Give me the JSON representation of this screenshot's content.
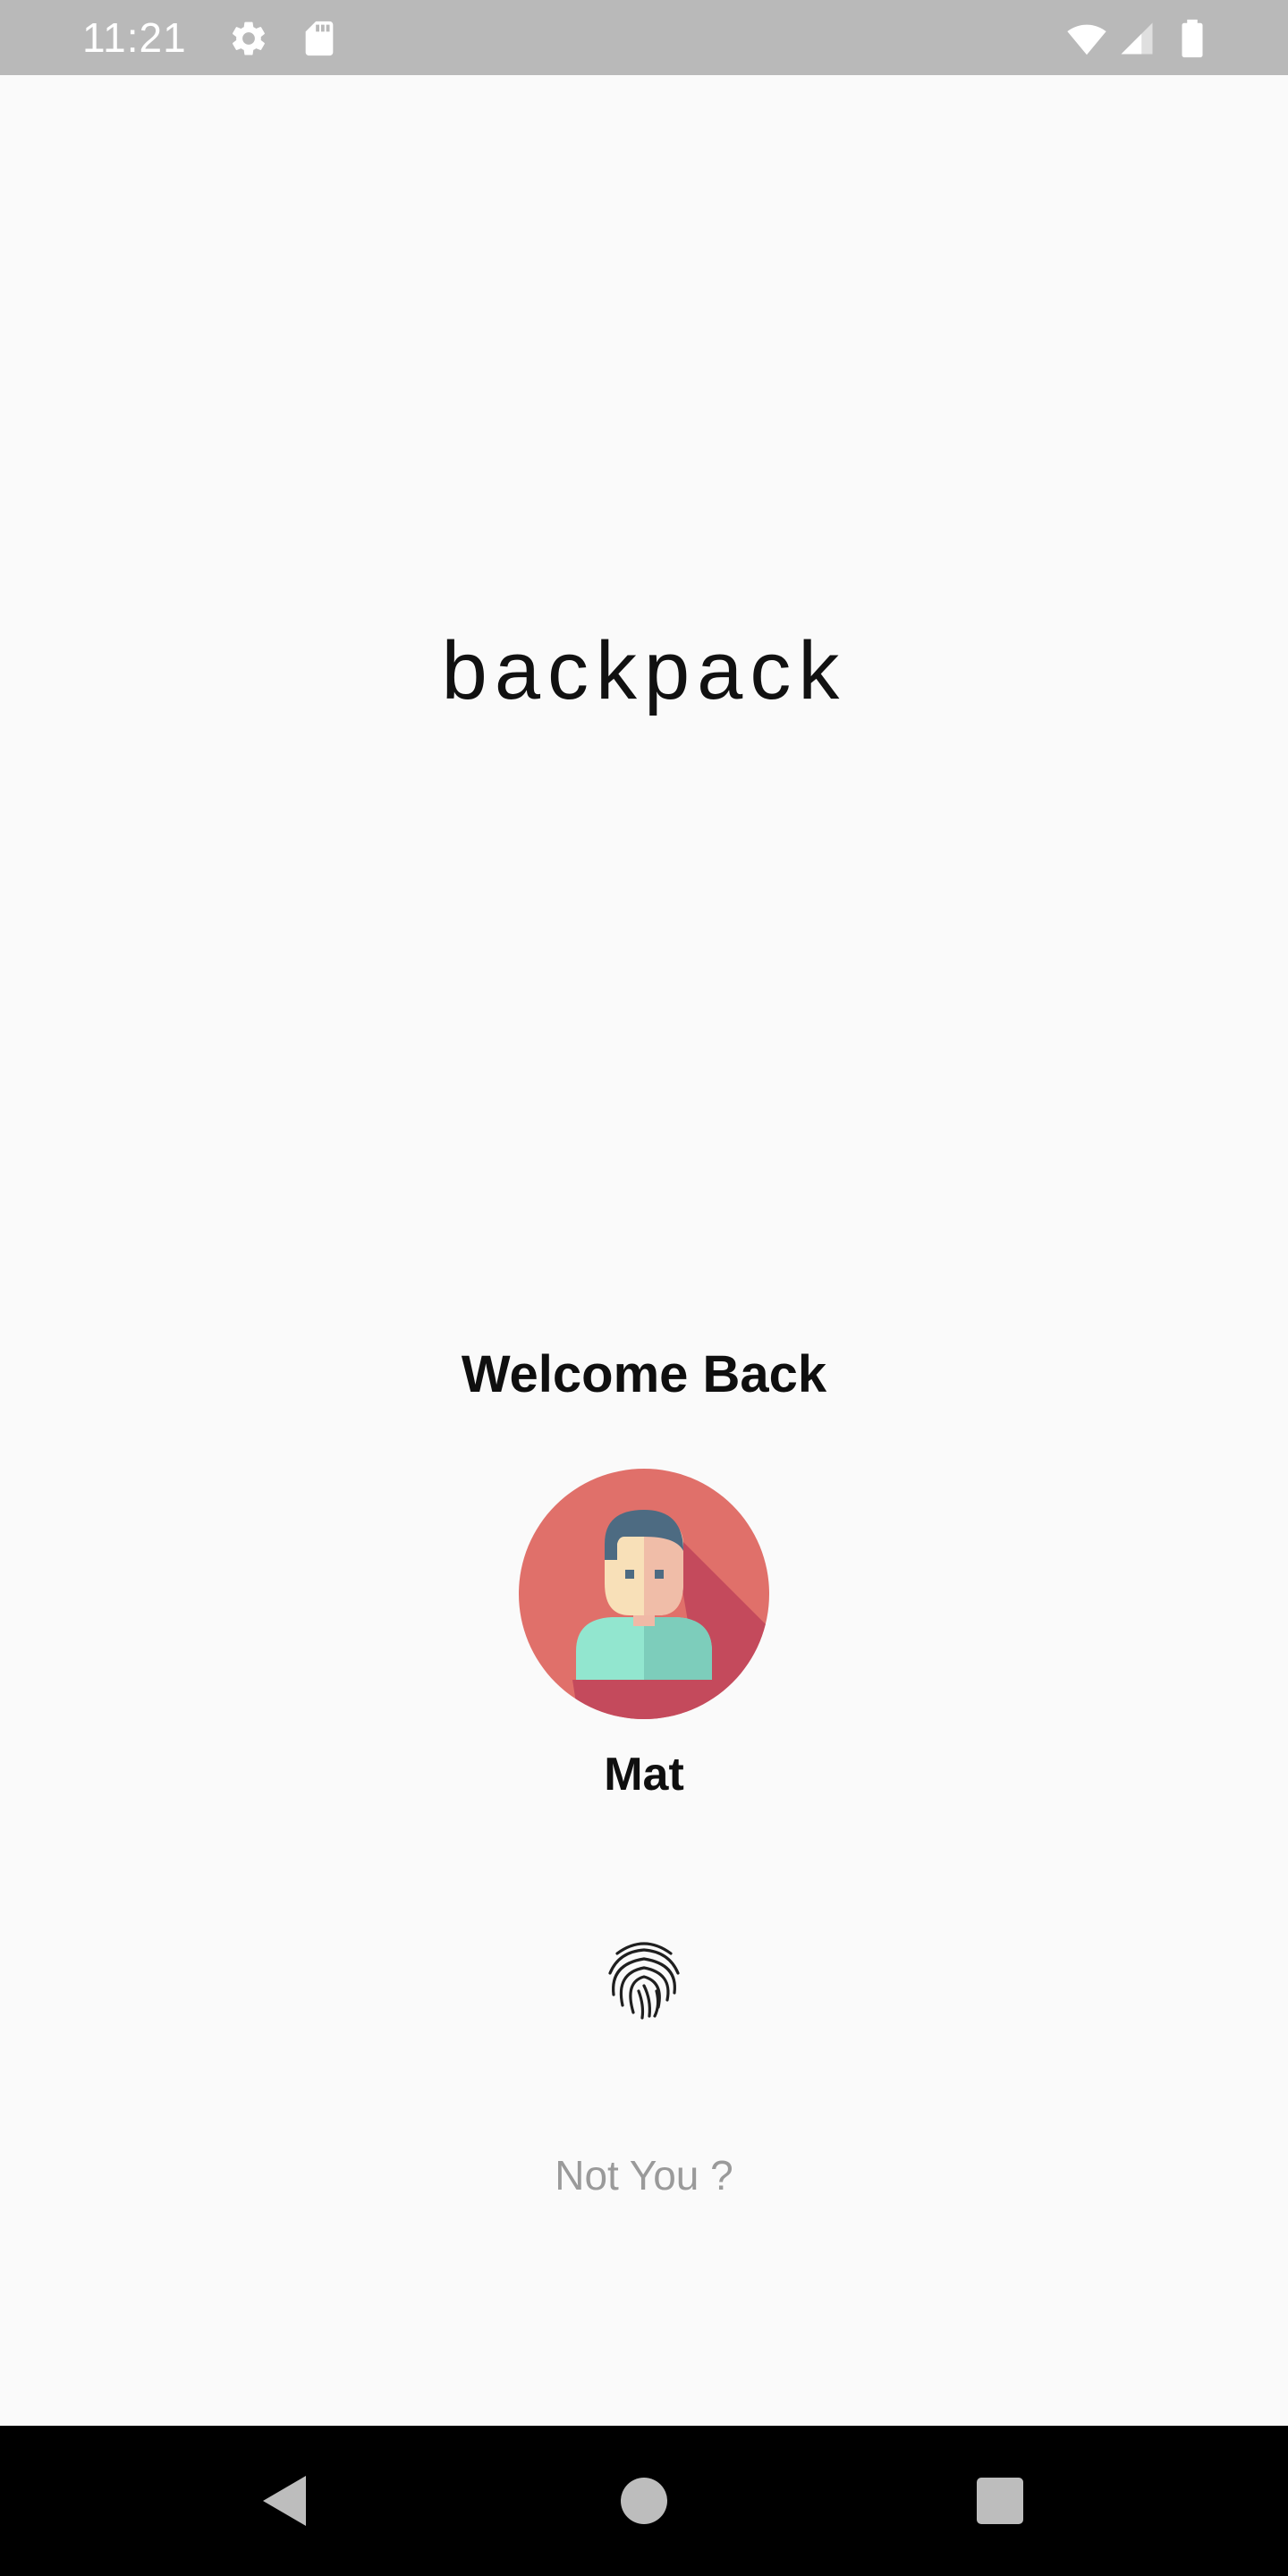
{
  "status_bar": {
    "time": "11:21",
    "icons": [
      "settings-icon",
      "sd-card-icon",
      "wifi-icon",
      "signal-icon",
      "battery-icon"
    ]
  },
  "app": {
    "title": "backpack"
  },
  "login": {
    "welcome": "Welcome Back",
    "username": "Mat",
    "not_you": "Not You ?",
    "avatar": "user-avatar",
    "fingerprint": "fingerprint-icon"
  },
  "nav_bar": {
    "buttons": [
      "back-icon",
      "home-icon",
      "recents-icon"
    ]
  },
  "colors": {
    "status_bar": "#b9b9b9",
    "background": "#fafafa",
    "avatar_bg": "#e0706a",
    "avatar_shadow": "#c44a5c",
    "muted_text": "#9a9a9a"
  }
}
